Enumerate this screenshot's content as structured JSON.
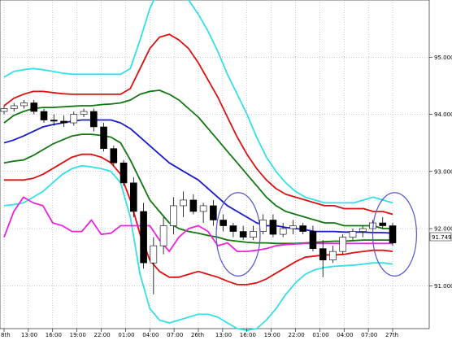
{
  "chart_data": {
    "type": "line",
    "instrument_kind": "candlestick with Bollinger-style bands",
    "x_tick_labels": [
      "8th",
      "13:00",
      "16:00",
      "19:00",
      "22:00",
      "01:00",
      "04:00",
      "07:00",
      "26th",
      "13:00",
      "16:00",
      "19:00",
      "22:00",
      "01:00",
      "04:00",
      "07:00",
      "27th"
    ],
    "y_tick_labels": [
      "95.000",
      "94.000",
      "93.000",
      "92.000",
      "91.000"
    ],
    "ylim": [
      90.25,
      96.0
    ],
    "current_price_label": "91.749",
    "grid": true,
    "colors": {
      "upper_band_3": "#33e0e8",
      "upper_band_2": "#dd1111",
      "upper_band_1": "#117711",
      "middle_line": "#1a1acc",
      "lower_band_1": "#117711",
      "lower_band_2": "#dd1111",
      "lower_band_3": "#33e0e8",
      "indicator_line": "#ee22dd",
      "ellipse": "#5555cc",
      "candle_up": "#ffffff",
      "candle_down": "#000000"
    },
    "x": [
      0,
      12,
      24,
      36,
      48,
      60,
      72,
      84,
      96,
      108,
      120,
      132,
      144,
      156,
      168,
      180,
      192,
      204,
      216,
      228,
      240,
      252,
      264,
      276,
      288,
      300,
      312,
      324,
      336,
      348,
      360,
      372,
      384,
      396,
      408,
      420,
      432,
      444,
      456,
      468,
      480
    ],
    "series": [
      {
        "key": "upper_band_3",
        "values": [
          94.65,
          94.75,
          94.78,
          94.8,
          94.78,
          94.75,
          94.72,
          94.7,
          94.7,
          94.7,
          94.7,
          94.7,
          94.7,
          94.8,
          95.3,
          95.85,
          96.2,
          96.25,
          96.15,
          96.0,
          95.75,
          95.45,
          95.1,
          94.7,
          94.35,
          94.0,
          93.6,
          93.25,
          93.0,
          92.8,
          92.65,
          92.55,
          92.5,
          92.45,
          92.45,
          92.45,
          92.45,
          92.5,
          92.55,
          92.5,
          92.45
        ]
      },
      {
        "key": "upper_band_2",
        "values": [
          94.15,
          94.28,
          94.35,
          94.4,
          94.4,
          94.38,
          94.36,
          94.35,
          94.35,
          94.35,
          94.35,
          94.35,
          94.35,
          94.45,
          94.8,
          95.15,
          95.35,
          95.4,
          95.3,
          95.15,
          94.9,
          94.6,
          94.3,
          93.95,
          93.6,
          93.3,
          93.05,
          92.85,
          92.7,
          92.6,
          92.55,
          92.5,
          92.45,
          92.4,
          92.4,
          92.35,
          92.35,
          92.35,
          92.3,
          92.3,
          92.25
        ]
      },
      {
        "key": "upper_band_1",
        "values": [
          93.85,
          93.98,
          94.05,
          94.1,
          94.12,
          94.12,
          94.13,
          94.14,
          94.15,
          94.15,
          94.17,
          94.18,
          94.2,
          94.25,
          94.35,
          94.4,
          94.42,
          94.35,
          94.25,
          94.1,
          93.95,
          93.75,
          93.55,
          93.35,
          93.15,
          92.95,
          92.75,
          92.55,
          92.4,
          92.3,
          92.25,
          92.2,
          92.15,
          92.1,
          92.1,
          92.05,
          92.05,
          92.05,
          92.05,
          92.0,
          92.0
        ]
      },
      {
        "key": "middle_line",
        "values": [
          93.5,
          93.55,
          93.62,
          93.7,
          93.78,
          93.82,
          93.85,
          93.88,
          93.9,
          93.9,
          93.9,
          93.9,
          93.85,
          93.75,
          93.6,
          93.45,
          93.3,
          93.15,
          93.05,
          92.95,
          92.85,
          92.7,
          92.55,
          92.4,
          92.3,
          92.2,
          92.1,
          92.05,
          92.05,
          92.02,
          92.0,
          91.98,
          91.95,
          91.95,
          91.95,
          91.94,
          91.94,
          91.94,
          91.93,
          91.93,
          91.92
        ]
      },
      {
        "key": "lower_band_1",
        "values": [
          93.15,
          93.18,
          93.2,
          93.28,
          93.38,
          93.48,
          93.55,
          93.62,
          93.65,
          93.65,
          93.63,
          93.6,
          93.5,
          93.2,
          92.85,
          92.5,
          92.3,
          92.1,
          92.0,
          91.95,
          91.92,
          91.88,
          91.85,
          91.8,
          91.78,
          91.76,
          91.75,
          91.75,
          91.74,
          91.74,
          91.74,
          91.75,
          91.76,
          91.77,
          91.78,
          91.78,
          91.79,
          91.8,
          91.8,
          91.8,
          91.8
        ]
      },
      {
        "key": "lower_band_2",
        "values": [
          92.85,
          92.85,
          92.85,
          92.88,
          92.95,
          93.05,
          93.15,
          93.25,
          93.3,
          93.3,
          93.25,
          93.15,
          92.95,
          92.5,
          91.9,
          91.45,
          91.25,
          91.15,
          91.15,
          91.2,
          91.25,
          91.2,
          91.15,
          91.08,
          91.02,
          91.02,
          91.05,
          91.12,
          91.22,
          91.32,
          91.42,
          91.5,
          91.52,
          91.54,
          91.54,
          91.55,
          91.58,
          91.6,
          91.62,
          91.62,
          91.6
        ]
      },
      {
        "key": "lower_band_3",
        "values": [
          92.4,
          92.42,
          92.45,
          92.55,
          92.65,
          92.8,
          92.95,
          93.05,
          93.1,
          93.08,
          93.05,
          93.0,
          92.8,
          92.2,
          91.2,
          90.6,
          90.4,
          90.35,
          90.4,
          90.45,
          90.5,
          90.5,
          90.45,
          90.35,
          90.25,
          90.22,
          90.25,
          90.4,
          90.6,
          90.85,
          91.05,
          91.2,
          91.28,
          91.32,
          91.34,
          91.35,
          91.36,
          91.38,
          91.4,
          91.4,
          91.38
        ]
      },
      {
        "key": "indicator_line",
        "values": [
          91.85,
          92.3,
          92.55,
          92.45,
          92.4,
          92.1,
          92.05,
          91.95,
          91.95,
          92.15,
          91.9,
          91.92,
          92.05,
          92.05,
          92.05,
          92.05,
          91.8,
          91.6,
          91.85,
          92.0,
          92.05,
          91.95,
          91.7,
          91.75,
          91.6,
          91.6,
          91.62,
          91.65,
          91.7,
          91.72,
          91.73,
          91.74,
          91.74,
          91.74,
          91.74,
          91.74,
          91.74,
          91.74,
          91.74,
          91.74,
          91.74
        ]
      }
    ],
    "candles": [
      {
        "o": 94.05,
        "h": 94.15,
        "l": 94.0,
        "c": 94.1
      },
      {
        "o": 94.1,
        "h": 94.2,
        "l": 94.05,
        "c": 94.15
      },
      {
        "o": 94.15,
        "h": 94.25,
        "l": 94.1,
        "c": 94.2
      },
      {
        "o": 94.2,
        "h": 94.25,
        "l": 94.0,
        "c": 94.05
      },
      {
        "o": 94.05,
        "h": 94.1,
        "l": 93.85,
        "c": 93.9
      },
      {
        "o": 93.9,
        "h": 94.0,
        "l": 93.8,
        "c": 93.88
      },
      {
        "o": 93.88,
        "h": 93.98,
        "l": 93.78,
        "c": 93.85
      },
      {
        "o": 93.85,
        "h": 94.05,
        "l": 93.8,
        "c": 94.0
      },
      {
        "o": 94.0,
        "h": 94.1,
        "l": 93.95,
        "c": 94.05
      },
      {
        "o": 94.05,
        "h": 94.1,
        "l": 93.7,
        "c": 93.78
      },
      {
        "o": 93.78,
        "h": 93.85,
        "l": 93.35,
        "c": 93.4
      },
      {
        "o": 93.4,
        "h": 93.45,
        "l": 93.1,
        "c": 93.15
      },
      {
        "o": 93.15,
        "h": 93.2,
        "l": 92.75,
        "c": 92.8
      },
      {
        "o": 92.8,
        "h": 92.9,
        "l": 92.2,
        "c": 92.3
      },
      {
        "o": 92.3,
        "h": 92.45,
        "l": 91.3,
        "c": 91.4
      },
      {
        "o": 91.4,
        "h": 91.85,
        "l": 90.85,
        "c": 91.7
      },
      {
        "o": 91.7,
        "h": 92.2,
        "l": 91.55,
        "c": 92.05
      },
      {
        "o": 92.05,
        "h": 92.55,
        "l": 91.9,
        "c": 92.4
      },
      {
        "o": 92.4,
        "h": 92.65,
        "l": 92.2,
        "c": 92.5
      },
      {
        "o": 92.5,
        "h": 92.6,
        "l": 92.25,
        "c": 92.3
      },
      {
        "o": 92.3,
        "h": 92.45,
        "l": 92.1,
        "c": 92.4
      },
      {
        "o": 92.4,
        "h": 92.5,
        "l": 92.05,
        "c": 92.15
      },
      {
        "o": 92.15,
        "h": 92.25,
        "l": 91.95,
        "c": 92.05
      },
      {
        "o": 92.05,
        "h": 92.1,
        "l": 91.85,
        "c": 91.95
      },
      {
        "o": 91.95,
        "h": 92.05,
        "l": 91.8,
        "c": 91.85
      },
      {
        "o": 91.85,
        "h": 92.05,
        "l": 91.8,
        "c": 91.95
      },
      {
        "o": 91.95,
        "h": 92.25,
        "l": 91.9,
        "c": 92.15
      },
      {
        "o": 92.15,
        "h": 92.25,
        "l": 91.85,
        "c": 91.9
      },
      {
        "o": 91.9,
        "h": 92.1,
        "l": 91.85,
        "c": 92.0
      },
      {
        "o": 92.0,
        "h": 92.15,
        "l": 91.9,
        "c": 92.05
      },
      {
        "o": 92.05,
        "h": 92.1,
        "l": 91.9,
        "c": 91.95
      },
      {
        "o": 91.95,
        "h": 92.05,
        "l": 91.6,
        "c": 91.65
      },
      {
        "o": 91.65,
        "h": 91.8,
        "l": 91.15,
        "c": 91.45
      },
      {
        "o": 91.45,
        "h": 91.7,
        "l": 91.4,
        "c": 91.6
      },
      {
        "o": 91.6,
        "h": 91.9,
        "l": 91.55,
        "c": 91.85
      },
      {
        "o": 91.85,
        "h": 92.0,
        "l": 91.8,
        "c": 91.95
      },
      {
        "o": 91.95,
        "h": 92.05,
        "l": 91.85,
        "c": 92.0
      },
      {
        "o": 92.0,
        "h": 92.15,
        "l": 91.95,
        "c": 92.1
      },
      {
        "o": 92.1,
        "h": 92.2,
        "l": 92.0,
        "c": 92.05
      },
      {
        "o": 92.05,
        "h": 92.1,
        "l": 91.7,
        "c": 91.75
      }
    ],
    "ellipses": [
      {
        "center_index": 23.5,
        "center_price": 91.9,
        "rx_bars": 2.2,
        "ry_price": 0.73
      },
      {
        "center_index": 39.2,
        "center_price": 91.9,
        "rx_bars": 2.2,
        "ry_price": 0.73
      }
    ]
  }
}
